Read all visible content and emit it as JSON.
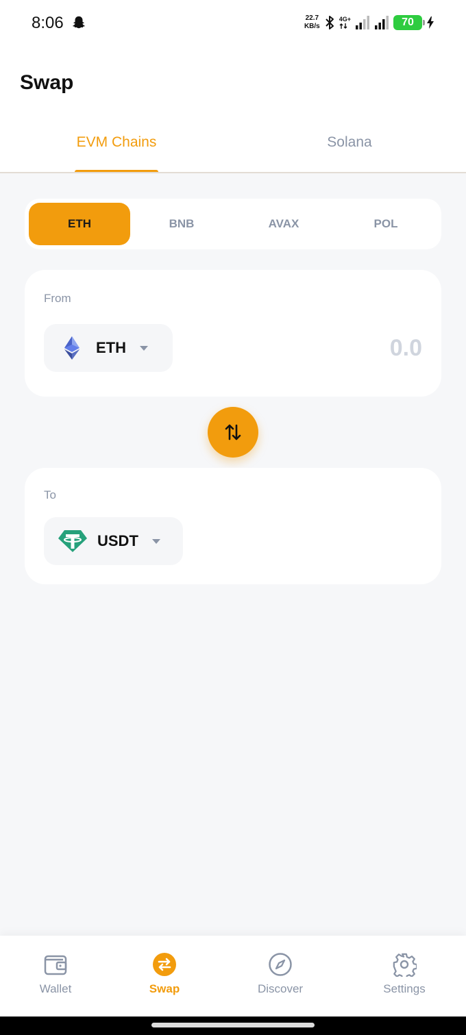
{
  "status": {
    "time": "8:06",
    "speed_value": "22.7",
    "speed_unit": "KB/s",
    "network": "4G+",
    "battery": "70"
  },
  "header": {
    "title": "Swap"
  },
  "tabs": [
    {
      "label": "EVM Chains",
      "active": true
    },
    {
      "label": "Solana",
      "active": false
    }
  ],
  "chains": [
    {
      "label": "ETH",
      "active": true
    },
    {
      "label": "BNB",
      "active": false
    },
    {
      "label": "AVAX",
      "active": false
    },
    {
      "label": "POL",
      "active": false
    }
  ],
  "from": {
    "label": "From",
    "token": "ETH",
    "amount": "0.0"
  },
  "to": {
    "label": "To",
    "token": "USDT"
  },
  "nav": [
    {
      "label": "Wallet",
      "active": false
    },
    {
      "label": "Swap",
      "active": true
    },
    {
      "label": "Discover",
      "active": false
    },
    {
      "label": "Settings",
      "active": false
    }
  ],
  "colors": {
    "accent": "#f29c0d",
    "muted": "#8a94a6",
    "usdt": "#26a17b",
    "eth": "#627eea"
  }
}
